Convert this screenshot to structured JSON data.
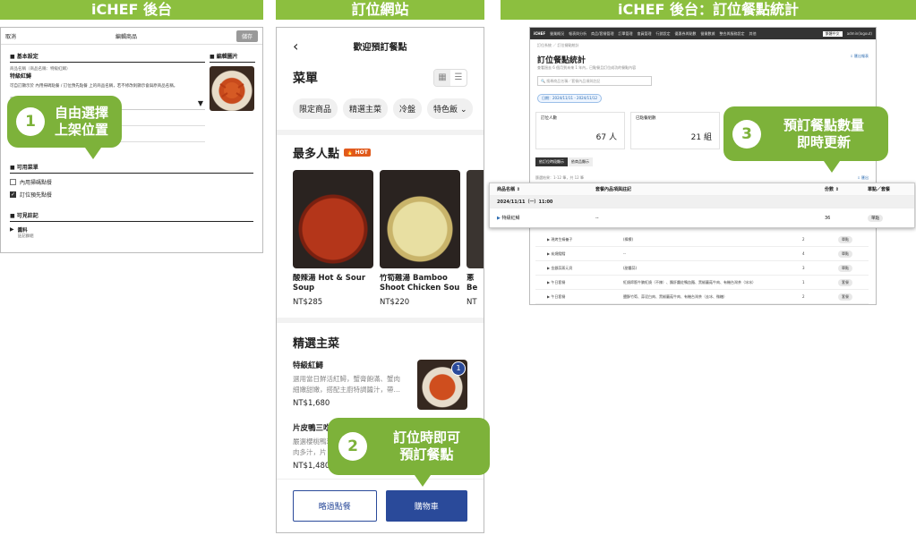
{
  "headers": {
    "left": "iCHEF 後台",
    "middle": "訂位網站",
    "right": "iCHEF 後台：訂位餐點統計"
  },
  "bubbles": {
    "b1": {
      "num": "1",
      "line1": "自由選擇",
      "line2": "上架位置"
    },
    "b2": {
      "num": "2",
      "line1": "訂位時即可",
      "line2": "預訂餐點"
    },
    "b3": {
      "num": "3",
      "line1": "預訂餐點數量",
      "line2": "即時更新"
    }
  },
  "edit_item": {
    "cancel": "取消",
    "title": "編輯商品",
    "save": "儲存",
    "basic_section": "基本設定",
    "image_section": "編輯圖片",
    "name_label": "商品名稱（商品名稱：特級紅鱘）",
    "name_value": "特級紅鱘",
    "hint": "可自訂顯示於 內用掃碼點餐 / 訂位預先點餐 上的商品名稱，若不修改則顯示會與原商品名稱。",
    "display_label": "商品類別",
    "display_value": "選",
    "menu_section": "可用菜單",
    "menus": [
      {
        "label": "內用掃碼點餐",
        "checked": false
      },
      {
        "label": "訂位預先點餐",
        "checked": true
      }
    ],
    "notes_section": "可見註記",
    "notes_item": "醬料",
    "notes_sub": "註記群組"
  },
  "booking": {
    "nav_title": "歡迎預訂餐點",
    "back": "‹",
    "menu_title": "菜單",
    "chips": [
      "限定商品",
      "精選主菜",
      "冷盤",
      "特色飯"
    ],
    "popular_title": "最多人點",
    "hot": "HOT",
    "popular_items": [
      {
        "name": "酸辣湯 Hot & Sour",
        "name2": "Soup",
        "price": "NT$285"
      },
      {
        "name": "竹筍雞湯 Bamboo",
        "name2": "Shoot Chicken Soup",
        "price": "NT$220"
      },
      {
        "name": "蔥",
        "name2": "Be",
        "price": "NT"
      }
    ],
    "section_title": "精選主菜",
    "items": [
      {
        "name": "特級紅鱘",
        "desc1": "選用當日鮮活紅鱘，蟹膏飽滿、蟹肉",
        "desc2": "細嫩甜嫩，搭配主廚特調醬汁，帶…",
        "price": "NT$1,680",
        "badge": "1"
      },
      {
        "name": "片皮鴨三吃",
        "desc1": "嚴選櫻桃鴨現烤現片，",
        "desc2": "肉多汁，片",
        "price": "NT$1,480"
      }
    ],
    "skip": "略過點餐",
    "cart": "購物車"
  },
  "stats": {
    "brand": "iCHEF",
    "nav": [
      "營業概況",
      "報表與分析",
      "商品/套餐管理",
      "訂單管理",
      "會員管理",
      "行銷設定",
      "優惠券與點數",
      "營業數據",
      "整合與服務設定",
      "其他"
    ],
    "lang": "繁體中文",
    "user": "admin(logout)",
    "crumb": "訂位系統 ／ 訂位餐點統計",
    "title": "訂位餐點統計",
    "subtitle": "查看過去 6 個月到未來 1 年內，已點餐且訂位成功的餐點內容",
    "export_link": "⇩ 匯出報表",
    "search_placeholder": "搜尋商品名稱／套餐內品項與註記",
    "date_filter": "日期：2024/11/11 - 2024/11/12",
    "stat1_label": "訂位人數",
    "stat1_value": "67 人",
    "stat2_label": "已點餐組數",
    "stat2_value": "21 組",
    "tab_active": "依訂位時段顯示",
    "tab_other": "依商品顯示",
    "result": "篩選結果：1-12 筆，共 12 筆",
    "export2": "⇩ 匯出",
    "col_name": "商品名稱 ⇕",
    "col_notes": "套餐內品項與註記",
    "col_qty": "份數 ⇕",
    "col_type": "單點／套餐",
    "group_label": "2024/11/11（一）11:00",
    "row1": {
      "name": "特級紅鱘",
      "notes": "--",
      "qty": "36",
      "type": "單點"
    },
    "rows": [
      {
        "name": "現烤生蠔養子",
        "notes": "(檸檬)",
        "qty": "2",
        "type": "單點"
      },
      {
        "name": "炭燒鱈鱈",
        "notes": "--",
        "qty": "4",
        "type": "單點"
      },
      {
        "name": "金銀蒜蒸元貝",
        "notes": "(甜醬蒜)",
        "qty": "3",
        "type": "單點"
      },
      {
        "name": "午日套餐",
        "notes": "紅燒蹄筋牛腩紅燒（不辣）、鵝肝醬佐鴨血麵、黑椒蘑菇牛肉、有機台灣茶（冰冰）",
        "qty": "1",
        "type": "套餐"
      },
      {
        "name": "午日套餐",
        "notes": "鹽酥竹筍、蒜泥白肉、黑椒蘑菇牛肉、有機台灣茶（去冰、微糖）",
        "qty": "2",
        "type": "套餐"
      }
    ]
  }
}
